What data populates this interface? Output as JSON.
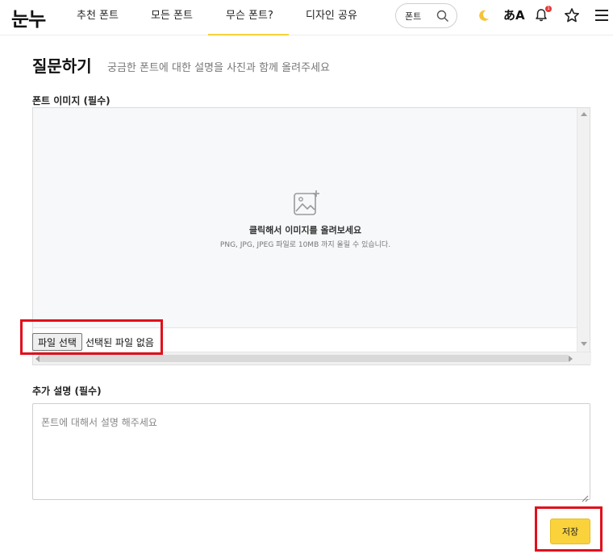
{
  "header": {
    "logo": "눈누",
    "nav": [
      {
        "label": "추천 폰트"
      },
      {
        "label": "모든 폰트"
      },
      {
        "label": "무슨 폰트?",
        "active": true
      },
      {
        "label": "디자인 공유"
      }
    ],
    "search": {
      "value": "폰트",
      "icon": "search-icon"
    },
    "icons": [
      "moon-icon",
      "translate-icon",
      "bell-icon",
      "star-icon",
      "menu-icon"
    ],
    "notification_count": "1",
    "translate_glyph": "あA"
  },
  "page": {
    "title": "질문하기",
    "subtitle": "궁금한 폰트에 대한 설명을 사진과 함께 올려주세요"
  },
  "image_field": {
    "label": "폰트 이미지 (필수)",
    "drop_main": "클릭해서 이미지를 올려보세요",
    "drop_hint": "PNG, JPG, JPEG 파일로 10MB 까지 올릴 수 있습니다.",
    "file_button": "파일 선택",
    "file_status": "선택된 파일 없음"
  },
  "description_field": {
    "label": "추가 설명 (필수)",
    "placeholder": "폰트에 대해서 설명 해주세요"
  },
  "save_button": "저장",
  "colors": {
    "accent": "#f9d23c",
    "annotation": "#e0101c",
    "moon": "#f6c338",
    "badge": "#e53935"
  }
}
